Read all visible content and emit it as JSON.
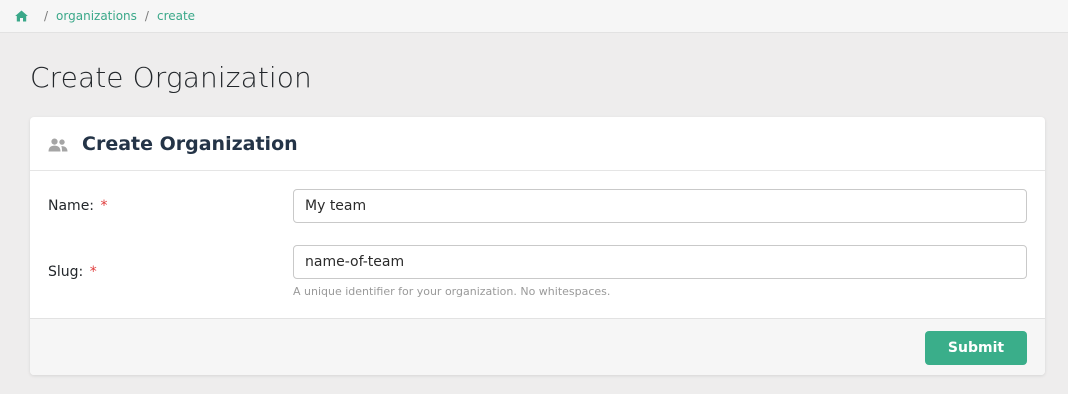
{
  "breadcrumb": {
    "home_icon": "home-icon",
    "separator": "/",
    "items": [
      "organizations",
      "create"
    ]
  },
  "page": {
    "title": "Create Organization"
  },
  "card": {
    "icon": "users-icon",
    "title": "Create Organization",
    "fields": {
      "name": {
        "label": "Name:",
        "required_mark": "*",
        "value": "My team"
      },
      "slug": {
        "label": "Slug:",
        "required_mark": "*",
        "value": "name-of-team",
        "help": "A unique identifier for your organization. No whitespaces."
      }
    },
    "submit_label": "Submit"
  },
  "colors": {
    "accent": "#3aae8a",
    "link": "#3aa889",
    "required": "#e03b3b",
    "background": "#eeeded"
  }
}
